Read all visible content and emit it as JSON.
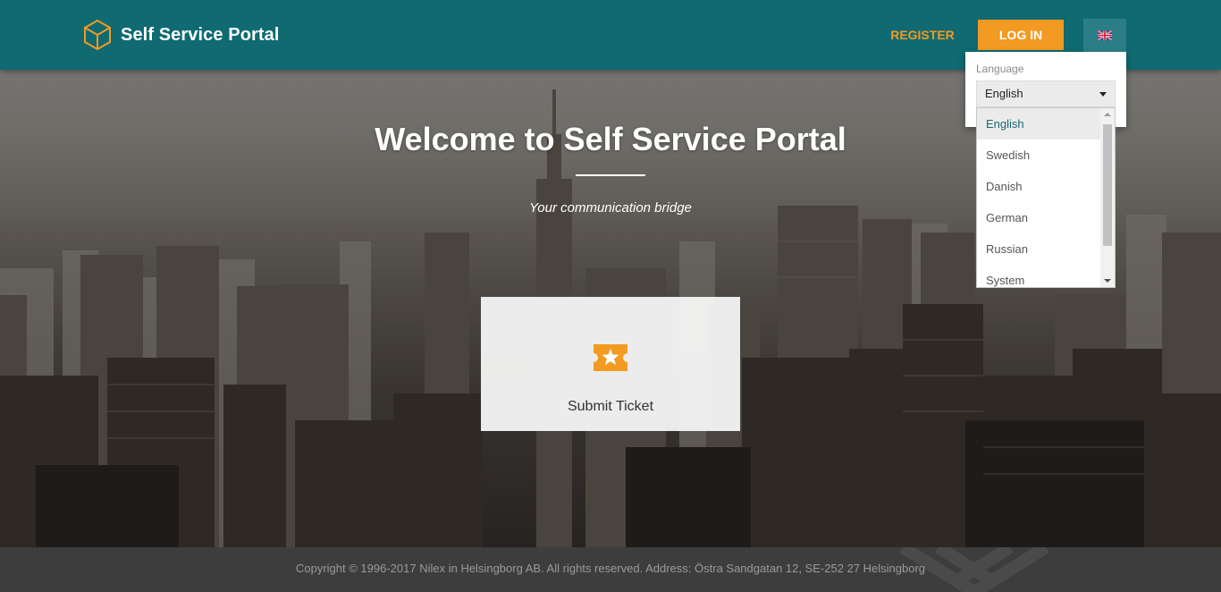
{
  "header": {
    "title": "Self Service Portal",
    "register_label": "REGISTER",
    "login_label": "LOG IN",
    "language_icon": "uk-flag-icon",
    "brand_icon": "cube-icon",
    "colors": {
      "header_bg": "#0f6a72",
      "accent": "#f39a22"
    }
  },
  "language_menu": {
    "label": "Language",
    "selected": "English",
    "options": [
      "English",
      "Swedish",
      "Danish",
      "German",
      "Russian",
      "System"
    ]
  },
  "hero": {
    "title": "Welcome to Self Service Portal",
    "tagline": "Your communication bridge"
  },
  "tiles": [
    {
      "label": "Submit Ticket",
      "icon": "ticket-star-icon"
    }
  ],
  "footer": {
    "text": "Copyright © 1996-2017 Nilex in Helsingborg AB. All rights reserved. Address: Östra Sandgatan 12, SE-252 27 Helsingborg"
  }
}
